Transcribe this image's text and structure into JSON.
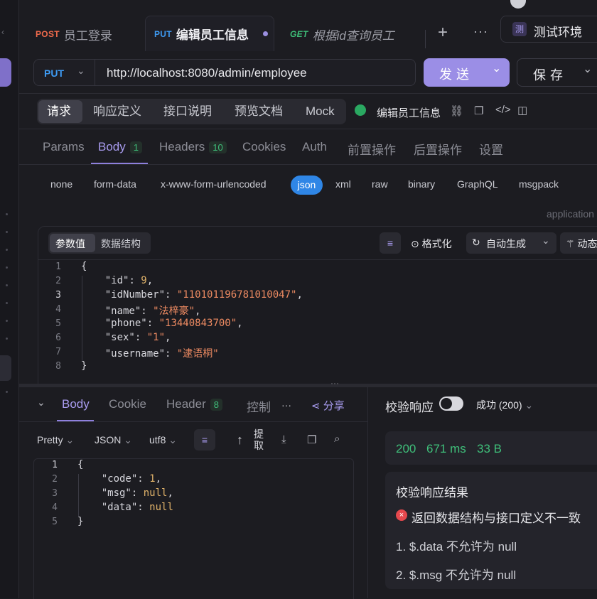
{
  "tabs": [
    {
      "method": "POST",
      "label": "员工登录"
    },
    {
      "method": "PUT",
      "label": "编辑员工信息"
    },
    {
      "method": "GET",
      "label": "根据id查询员工"
    }
  ],
  "environment": {
    "badge": "测",
    "label": "测试环境"
  },
  "request": {
    "method": "PUT",
    "url": "http://localhost:8080/admin/employee",
    "send_label": "发送",
    "save_label": "保存"
  },
  "segments": [
    "请求",
    "响应定义",
    "接口说明",
    "预览文档",
    "Mock"
  ],
  "api_name": "编辑员工信息",
  "param_tabs": {
    "params": "Params",
    "body": "Body",
    "body_count": "1",
    "headers": "Headers",
    "headers_count": "10",
    "cookies": "Cookies",
    "auth": "Auth",
    "pre": "前置操作",
    "post": "后置操作",
    "settings": "设置"
  },
  "body_types": [
    "none",
    "form-data",
    "x-www-form-urlencoded",
    "json",
    "xml",
    "raw",
    "binary",
    "GraphQL",
    "msgpack"
  ],
  "content_type_hint": "application",
  "editor": {
    "tab_values": "参数值",
    "tab_schema": "数据结构",
    "format_label": "格式化",
    "autogen_label": "自动生成",
    "dynamic_label": "动态",
    "lines": [
      "1",
      "2",
      "3",
      "4",
      "5",
      "6",
      "7",
      "8"
    ],
    "body": {
      "id": "9",
      "idNumber": "\"110101196781010047\"",
      "name": "\"法梓豪\"",
      "phone": "\"13440843700\"",
      "sex": "\"1\"",
      "username": "\"逮语桐\""
    }
  },
  "response": {
    "tabs": {
      "body": "Body",
      "cookie": "Cookie",
      "header": "Header",
      "header_count": "8",
      "console": "控制",
      "share": "分享"
    },
    "format": "Pretty",
    "type": "JSON",
    "encoding": "utf8",
    "extract": "提取",
    "lines": [
      "1",
      "2",
      "3",
      "4",
      "5"
    ],
    "json": {
      "code": "1",
      "msg": "null",
      "data": "null"
    },
    "validate_label": "校验响应",
    "status_select": "成功 (200)",
    "status_code": "200",
    "time": "671 ms",
    "size": "33 B",
    "result_title": "校验响应结果",
    "result_error": "返回数据结构与接口定义不一致",
    "result_items": [
      "1. $.data 不允许为 null",
      "2. $.msg 不允许为 null"
    ]
  },
  "colors": {
    "accent": "#9b8ee6",
    "put": "#3e9bf3",
    "post": "#ef6a4c",
    "get": "#3ebd78",
    "success": "#3fbf7a",
    "error": "#e5484d"
  }
}
